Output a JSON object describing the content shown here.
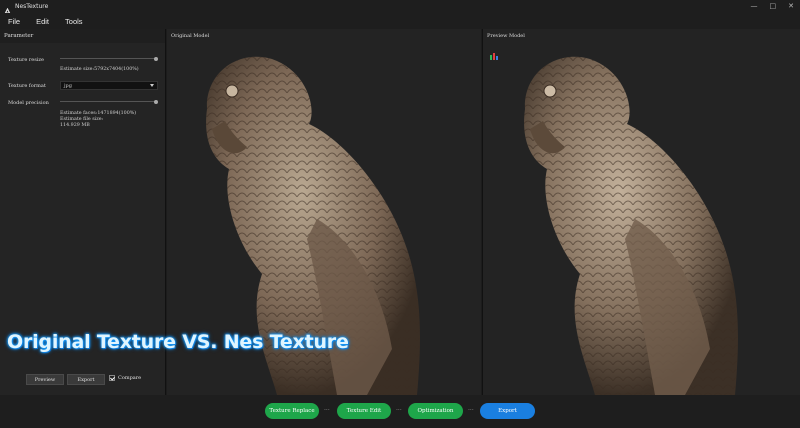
{
  "window": {
    "title": "NesTexture",
    "controls": [
      "—",
      "□",
      "✕"
    ]
  },
  "menu": {
    "items": [
      "File",
      "Edit",
      "Tools"
    ]
  },
  "parameter_panel": {
    "header": "Parameter",
    "texture_resize": {
      "label": "Texture resize",
      "estimate": "Estimate size:5792x7404(100%)"
    },
    "texture_format": {
      "label": "Texture format",
      "value": "jpg"
    },
    "model_precision": {
      "label": "Model precision",
      "estimate_faces": "Estimate faces:1471894(100%)",
      "estimate_file_size_label": "Estimate file size:",
      "estimate_file_size_value": "114.929 MB"
    },
    "buttons": {
      "preview": "Preview",
      "export": "Export",
      "compare": "Compare"
    }
  },
  "viewports": {
    "original_label": "Original Model",
    "preview_label": "Preview Model"
  },
  "overlay_caption": "Original Texture VS. Nes Texture",
  "workflow": {
    "steps": [
      "Texture Replace",
      "Texture Edit",
      "Optimization",
      "Export"
    ],
    "separator": "···"
  },
  "colors": {
    "green_step": "#1ea64a",
    "blue_step": "#1a7fe0",
    "caption_glow": "#1aa0ff"
  }
}
